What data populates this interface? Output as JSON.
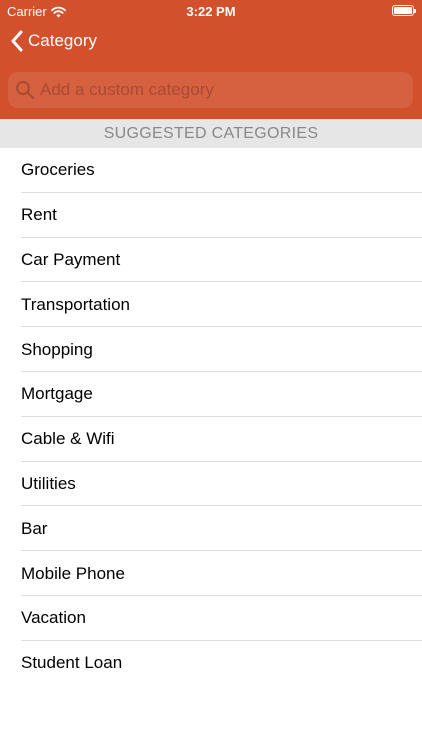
{
  "status_bar": {
    "carrier": "Carrier",
    "time": "3:22 PM"
  },
  "nav": {
    "back_label": "Category"
  },
  "search": {
    "placeholder": "Add a custom category",
    "value": ""
  },
  "section": {
    "title": "SUGGESTED CATEGORIES"
  },
  "categories": [
    {
      "label": "Groceries"
    },
    {
      "label": "Rent"
    },
    {
      "label": "Car Payment"
    },
    {
      "label": "Transportation"
    },
    {
      "label": "Shopping"
    },
    {
      "label": "Mortgage"
    },
    {
      "label": "Cable & Wifi"
    },
    {
      "label": "Utilities"
    },
    {
      "label": "Bar"
    },
    {
      "label": "Mobile Phone"
    },
    {
      "label": "Vacation"
    },
    {
      "label": "Student Loan"
    }
  ],
  "icons": {
    "status": [
      "wifi-icon",
      "battery-icon"
    ],
    "nav": "chevron-left-icon",
    "search": "search-icon"
  },
  "colors": {
    "header_background": "#d2502c",
    "section_background": "#e6e6e6",
    "section_text": "#888888",
    "separator": "#dcdcdc"
  }
}
